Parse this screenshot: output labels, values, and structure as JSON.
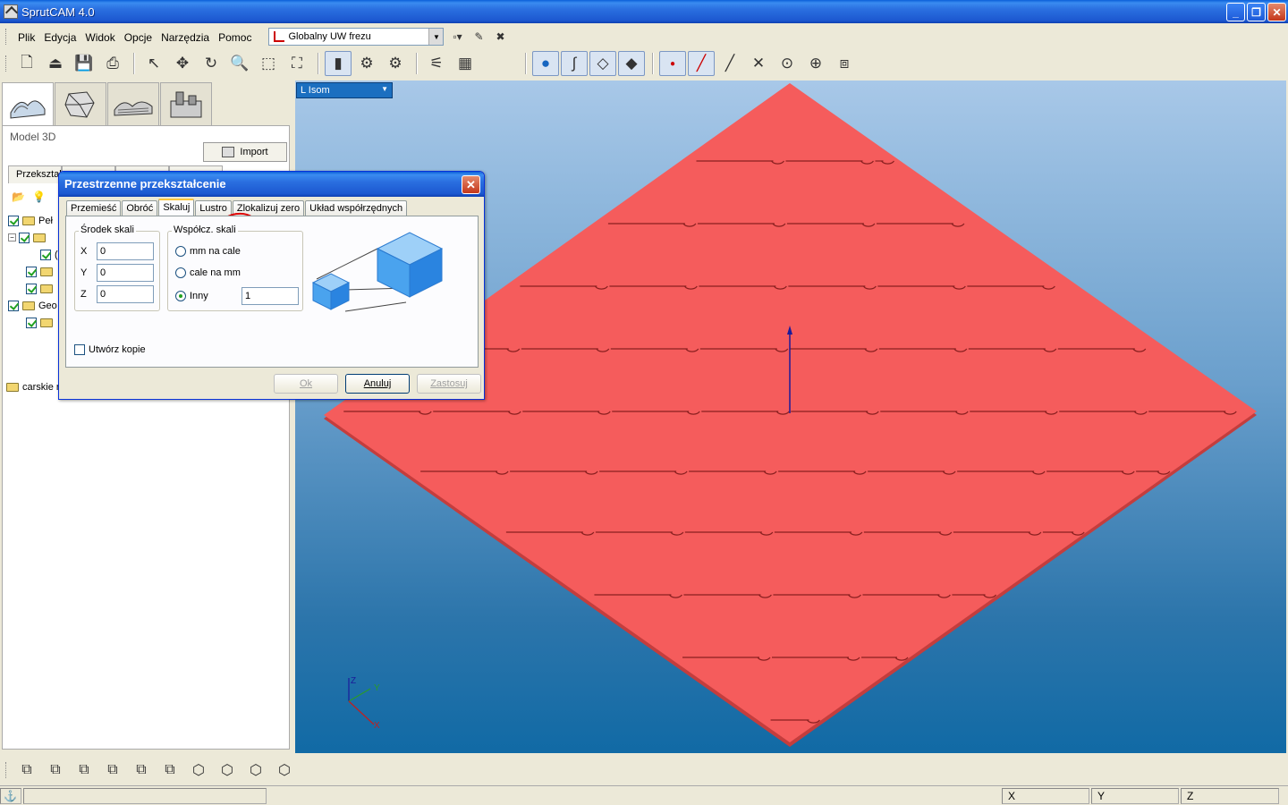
{
  "app": {
    "title": "SprutCAM 4.0"
  },
  "menu": {
    "items": [
      "Plik",
      "Edycja",
      "Widok",
      "Opcje",
      "Narzędzia",
      "Pomoc"
    ],
    "coord_system": "Globalny UW frezu"
  },
  "left_panel": {
    "section_title": "Model 3D",
    "import_label": "Import",
    "transform_tab_label": "Przekształ",
    "tree": [
      {
        "label": "Peł"
      },
      {
        "label": ""
      },
      {
        "label": "("
      },
      {
        "label": ""
      },
      {
        "label": ""
      },
      {
        "label": "Geo"
      },
      {
        "label": ""
      }
    ],
    "file_label": "carskie re"
  },
  "viewport": {
    "view_name": "L Isom",
    "axis_z": "Z",
    "axis_y": "Y",
    "axis_x": "X",
    "colors": {
      "part": "#f55c5c",
      "part_edge": "#c43d3d"
    }
  },
  "dialog": {
    "title": "Przestrzenne przekształcenie",
    "tabs": [
      "Przemieść",
      "Obróć",
      "Skaluj",
      "Lustro",
      "Zlokalizuj zero",
      "Układ współrzędnych"
    ],
    "active_tab": "Skaluj",
    "center_group": {
      "label": "Środek skali",
      "x_label": "X",
      "x_value": "0",
      "y_label": "Y",
      "y_value": "0",
      "z_label": "Z",
      "z_value": "0"
    },
    "factor_group": {
      "label": "Współcz. skali",
      "option_mm_to_inch": "mm na cale",
      "option_inch_to_mm": "cale na mm",
      "option_other": "Inny",
      "other_value": "1",
      "selected": "Inny"
    },
    "copy_label": "Utwórz kopie",
    "copy_checked": false,
    "buttons": {
      "ok": "Ok",
      "cancel": "Anuluj",
      "apply": "Zastosuj"
    }
  },
  "status": {
    "x_label": "X",
    "y_label": "Y",
    "z_label": "Z"
  }
}
